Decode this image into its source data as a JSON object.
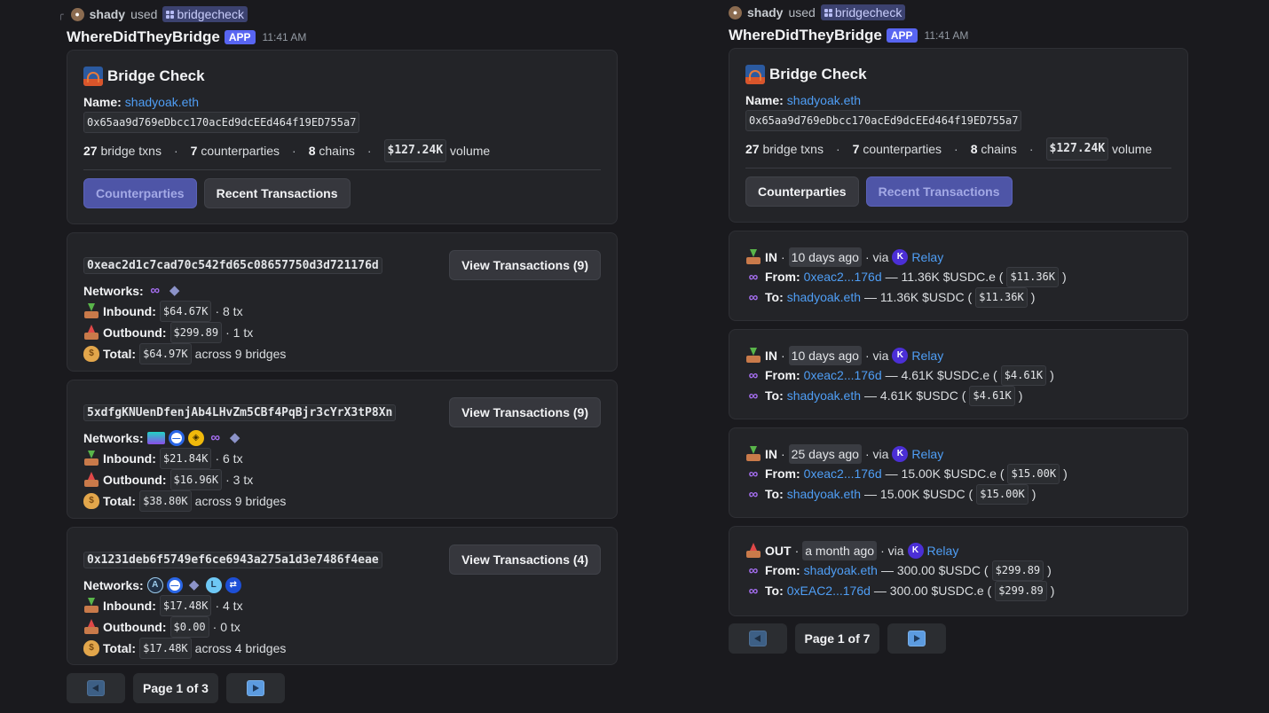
{
  "left": {
    "used": {
      "user": "shady",
      "used": "used",
      "command": "bridgecheck"
    },
    "author": {
      "name": "WhereDidTheyBridge",
      "badge": "APP",
      "time": "11:41 AM"
    },
    "summary": {
      "title": "Bridge Check",
      "name_label": "Name:",
      "name_value": "shadyoak.eth",
      "address": "0x65aa9d769eDbcc170acEd9dcEEd464f19ED755a7",
      "stats": [
        {
          "count": "27",
          "label": "bridge txns"
        },
        {
          "count": "7",
          "label": "counterparties"
        },
        {
          "count": "8",
          "label": "chains"
        }
      ],
      "volume": "$127.24K",
      "volume_label": "volume",
      "buttons": {
        "counterparties": "Counterparties",
        "recent": "Recent Transactions"
      }
    },
    "counterparties": [
      {
        "address": "0xeac2d1c7cad70c542fd65c08657750d3d721176d",
        "button": "View Transactions (9)",
        "networks_label": "Networks:",
        "networks": [
          "polygon-icon",
          "ethereum-icon"
        ],
        "inbound_label": "Inbound:",
        "inbound": "$64.67K",
        "inbound_tx": "· 8 tx",
        "outbound_label": "Outbound:",
        "outbound": "$299.89",
        "outbound_tx": "· 1 tx",
        "total_label": "Total:",
        "total": "$64.97K",
        "total_suffix": "across 9 bridges"
      },
      {
        "address": "5xdfgKNUenDfenjAb4LHvZm5CBf4PqBjr3cYrX3tP8Xn",
        "button": "View Transactions (9)",
        "networks_label": "Networks:",
        "networks": [
          "solana-icon",
          "optimism-icon",
          "bnb-icon",
          "polygon-icon",
          "ethereum-icon"
        ],
        "inbound_label": "Inbound:",
        "inbound": "$21.84K",
        "inbound_tx": "· 6 tx",
        "outbound_label": "Outbound:",
        "outbound": "$16.96K",
        "outbound_tx": "· 3 tx",
        "total_label": "Total:",
        "total": "$38.80K",
        "total_suffix": "across 9 bridges"
      },
      {
        "address": "0x1231deb6f5749ef6ce6943a275a1d3e7486f4eae",
        "button": "View Transactions (4)",
        "networks_label": "Networks:",
        "networks": [
          "arbitrum-icon",
          "optimism-icon",
          "ethereum-icon",
          "lens-icon",
          "across-icon"
        ],
        "inbound_label": "Inbound:",
        "inbound": "$17.48K",
        "inbound_tx": "· 4 tx",
        "outbound_label": "Outbound:",
        "outbound": "$0.00",
        "outbound_tx": "· 0 tx",
        "total_label": "Total:",
        "total": "$17.48K",
        "total_suffix": "across 4 bridges"
      }
    ],
    "pagination": {
      "page": "Page 1 of 3"
    }
  },
  "right": {
    "used": {
      "user": "shady",
      "used": "used",
      "command": "bridgecheck"
    },
    "author": {
      "name": "WhereDidTheyBridge",
      "badge": "APP",
      "time": "11:41 AM"
    },
    "summary": {
      "title": "Bridge Check",
      "name_label": "Name:",
      "name_value": "shadyoak.eth",
      "address": "0x65aa9d769eDbcc170acEd9dcEEd464f19ED755a7",
      "stats": [
        {
          "count": "27",
          "label": "bridge txns"
        },
        {
          "count": "7",
          "label": "counterparties"
        },
        {
          "count": "8",
          "label": "chains"
        }
      ],
      "volume": "$127.24K",
      "volume_label": "volume",
      "buttons": {
        "counterparties": "Counterparties",
        "recent": "Recent Transactions"
      }
    },
    "transactions": [
      {
        "dir": "IN",
        "time": "10 days ago",
        "via": "· via",
        "bridge": "Relay",
        "from_label": "From:",
        "from": "0xeac2...176d",
        "from_amount": "— 11.36K $USDC.e (",
        "from_usd": "$11.36K",
        "from_close": ")",
        "to_label": "To:",
        "to": "shadyoak.eth",
        "to_amount": "— 11.36K $USDC (",
        "to_usd": "$11.36K",
        "to_close": ")"
      },
      {
        "dir": "IN",
        "time": "10 days ago",
        "via": "· via",
        "bridge": "Relay",
        "from_label": "From:",
        "from": "0xeac2...176d",
        "from_amount": "— 4.61K $USDC.e (",
        "from_usd": "$4.61K",
        "from_close": ")",
        "to_label": "To:",
        "to": "shadyoak.eth",
        "to_amount": "— 4.61K $USDC (",
        "to_usd": "$4.61K",
        "to_close": ")"
      },
      {
        "dir": "IN",
        "time": "25 days ago",
        "via": "· via",
        "bridge": "Relay",
        "from_label": "From:",
        "from": "0xeac2...176d",
        "from_amount": "— 15.00K $USDC.e (",
        "from_usd": "$15.00K",
        "from_close": ")",
        "to_label": "To:",
        "to": "shadyoak.eth",
        "to_amount": "— 15.00K $USDC (",
        "to_usd": "$15.00K",
        "to_close": ")"
      },
      {
        "dir": "OUT",
        "time": "a month ago",
        "via": "· via",
        "bridge": "Relay",
        "from_label": "From:",
        "from": "shadyoak.eth",
        "from_amount": "— 300.00 $USDC (",
        "from_usd": "$299.89",
        "from_close": ")",
        "to_label": "To:",
        "to": "0xEAC2...176d",
        "to_amount": "— 300.00 $USDC.e (",
        "to_usd": "$299.89",
        "to_close": ")"
      }
    ],
    "pagination": {
      "page": "Page 1 of 7"
    }
  }
}
